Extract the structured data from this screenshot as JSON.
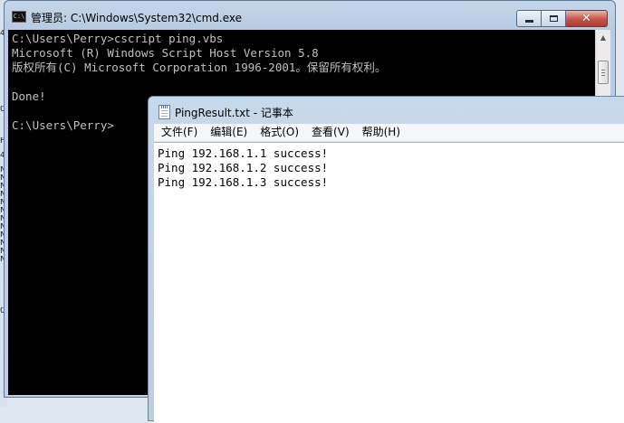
{
  "desktop": {
    "edge_glyphs": [
      "4",
      "0",
      "F",
      "4",
      "N",
      "N",
      "N",
      "N",
      "N",
      "N",
      "N",
      "N",
      "N",
      "N",
      "N",
      "N",
      "0"
    ]
  },
  "cmd_window": {
    "title": "管理员: C:\\Windows\\System32\\cmd.exe",
    "icon_text": "C:\\",
    "lines": [
      "C:\\Users\\Perry>cscript ping.vbs",
      "Microsoft (R) Windows Script Host Version 5.8",
      "版权所有(C) Microsoft Corporation 1996-2001。保留所有权利。",
      "",
      "Done!",
      "",
      "C:\\Users\\Perry>"
    ],
    "scroll_up": "▲",
    "close_glyph": "✕"
  },
  "notepad_window": {
    "title": "PingResult.txt - 记事本",
    "menu": [
      "文件(F)",
      "编辑(E)",
      "格式(O)",
      "查看(V)",
      "帮助(H)"
    ],
    "lines": [
      "Ping 192.168.1.1 success!",
      "Ping 192.168.1.2 success!",
      "Ping 192.168.1.3 success!"
    ]
  },
  "colors": {
    "console_background": "#000000",
    "console_text": "#c0c0c0",
    "close_button": "#c2544a"
  }
}
